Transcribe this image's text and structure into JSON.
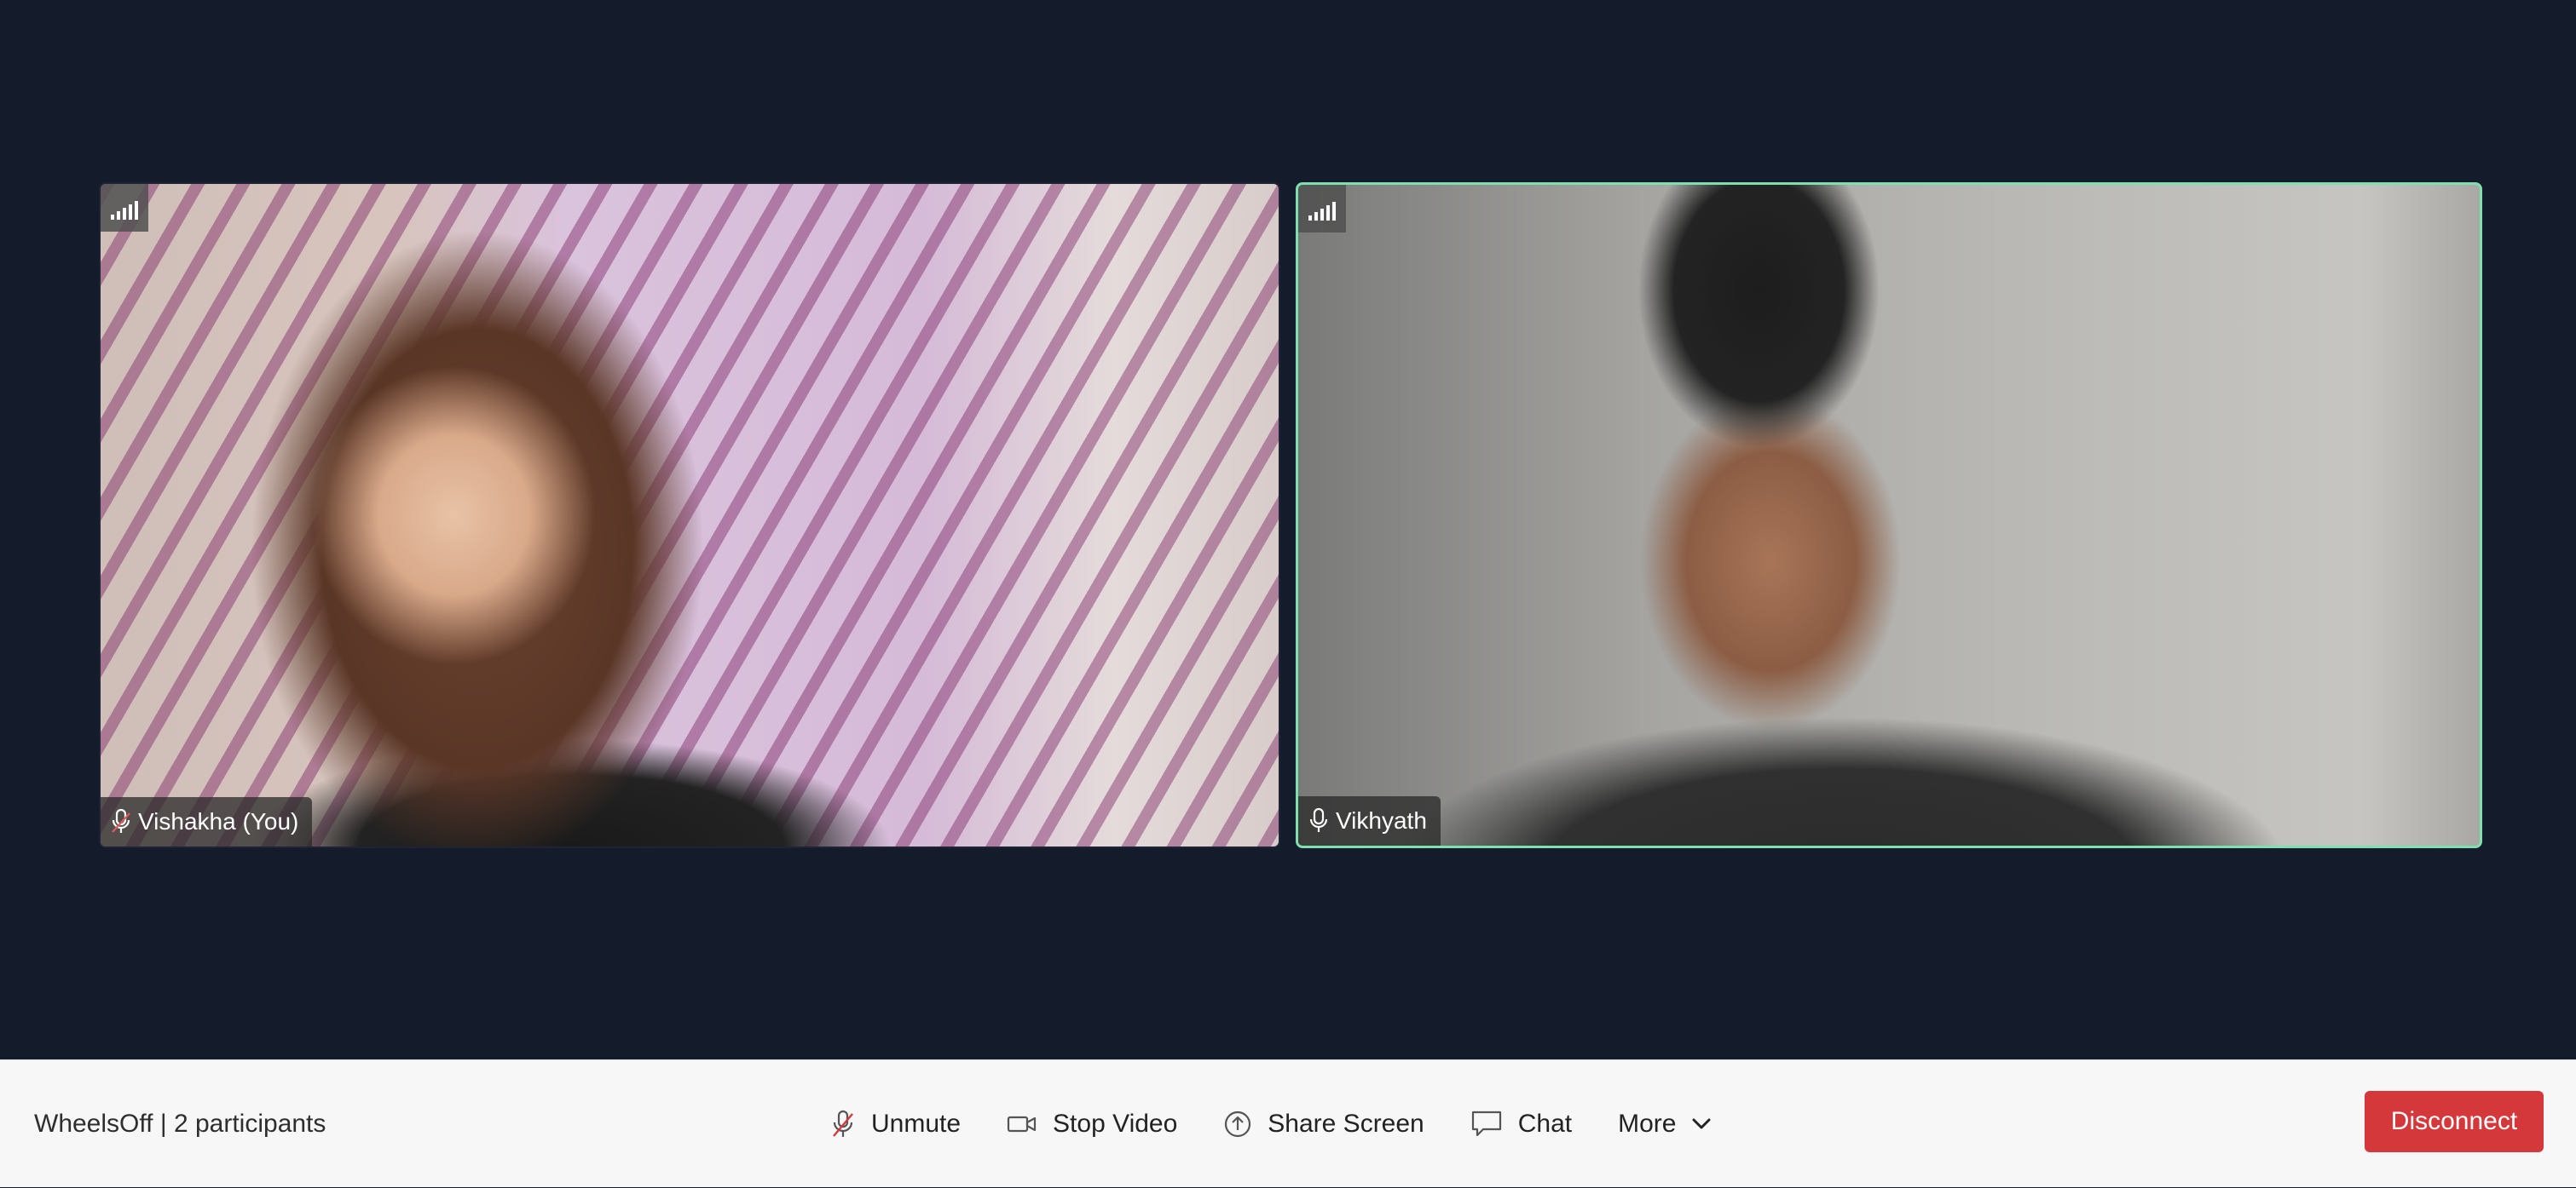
{
  "participants": [
    {
      "name": "Vishakha (You)"
    },
    {
      "name": "Vikhyath"
    }
  ],
  "toolbar": {
    "meeting_info": "WheelsOff | 2 participants",
    "unmute_label": "Unmute",
    "stop_video_label": "Stop Video",
    "share_screen_label": "Share Screen",
    "chat_label": "Chat",
    "more_label": "More",
    "disconnect_label": "Disconnect"
  },
  "colors": {
    "background": "#141b2b",
    "active_speaker_border": "#7fe0ae",
    "disconnect_button": "#d5383a",
    "toolbar_background": "#f7f7f7"
  },
  "icons": {
    "signal": "signal-strength-icon",
    "tile_mic": "microphone-icon",
    "unmute": "muted-microphone-icon",
    "video": "video-camera-icon",
    "share": "upload-arrow-icon",
    "chat": "chat-bubble-icon",
    "more": "chevron-down-icon"
  }
}
